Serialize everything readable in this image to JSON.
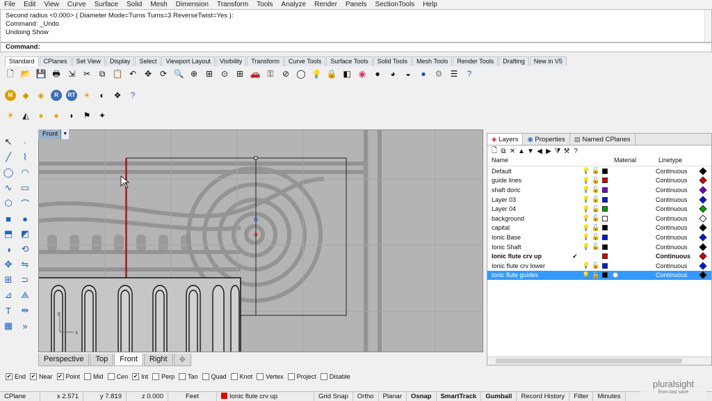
{
  "menu": [
    "File",
    "Edit",
    "View",
    "Curve",
    "Surface",
    "Solid",
    "Mesh",
    "Dimension",
    "Transform",
    "Tools",
    "Analyze",
    "Render",
    "Panels",
    "SectionTools",
    "Help"
  ],
  "history": {
    "lines": [
      "Second radius <0.000> ( Diameter  Mode=Turns  Turns=3  ReverseTwist=Yes ):",
      "Command: _Undo",
      "Undoing Show"
    ]
  },
  "command": {
    "prompt": "Command:"
  },
  "toolbar_tabs": [
    "Standard",
    "CPlanes",
    "Set View",
    "Display",
    "Select",
    "Viewport Layout",
    "Visibility",
    "Transform",
    "Curve Tools",
    "Surface Tools",
    "Solid Tools",
    "Mesh Tools",
    "Render Tools",
    "Drafting",
    "New in V5"
  ],
  "toolbar_rows": {
    "standard": [
      "new-icon",
      "open-icon",
      "save-icon",
      "print-icon",
      "import-icon",
      "cut-icon",
      "copy-icon",
      "paste-icon",
      "undo-icon",
      "pan-icon",
      "rotate-view-icon",
      "zoom-icon",
      "zoom-window-icon",
      "zoom-extents-icon",
      "zoom-selected-icon",
      "four-viewports-icon",
      "car-icon",
      "key-icon",
      "cplane-icon",
      "ellipse-icon",
      "light-icon",
      "lock-icon",
      "layer-icon",
      "color-wheel-icon",
      "sphere-icon",
      "shaded-sphere-icon",
      "render-sphere-icon",
      "blue-ball-icon",
      "gear-icon",
      "options-icon",
      "help-icon"
    ],
    "render": [
      "m-icon",
      "texture-icon",
      "label-icon",
      "r-icon",
      "rt-icon",
      "sun-icon",
      "material-icon",
      "environment-icon",
      "help-icon"
    ],
    "lights": [
      "sun-light-icon",
      "spotlight-icon",
      "point-light-icon",
      "directional-light-icon",
      "linear-light-icon",
      "flag-icon",
      "star-light-icon"
    ]
  },
  "left_tools": [
    "select-arrow-icon",
    "point-icon",
    "line-icon",
    "polyline-icon",
    "circle-icon",
    "arc-icon",
    "curve-icon",
    "rectangle-icon",
    "polygon-icon",
    "fillet-icon",
    "box-icon",
    "sphere-tool-icon",
    "extrude-icon",
    "surface-icon",
    "boolean-icon",
    "transform-icon",
    "move-icon",
    "mirror-icon",
    "array-icon",
    "join-icon",
    "analyze-icon",
    "snap-icon",
    "text-icon",
    "dim-icon",
    "group-icon",
    "more-icon"
  ],
  "viewport": {
    "title": "Front",
    "tabs": [
      "Perspective",
      "Top",
      "Front",
      "Right"
    ],
    "active_tab": "Front",
    "axis_x": "x",
    "axis_z": "z"
  },
  "panel": {
    "tabs": [
      "Layers",
      "Properties",
      "Named CPlanes"
    ],
    "headers": {
      "name": "Name",
      "material": "Material",
      "linetype": "Linetype"
    },
    "layers": [
      {
        "name": "Default",
        "color": "#000000",
        "linetype": "Continuous",
        "diamond": "#000000"
      },
      {
        "name": "guide lines",
        "color": "#d40000",
        "linetype": "Continuous",
        "diamond": "#d40000"
      },
      {
        "name": "shaft doric",
        "color": "#7a00c8",
        "linetype": "Continuous",
        "diamond": "#7a00c8"
      },
      {
        "name": "Layer 03",
        "color": "#0018e0",
        "linetype": "Continuous",
        "diamond": "#0018e0"
      },
      {
        "name": "Layer 04",
        "color": "#00a000",
        "linetype": "Continuous",
        "diamond": "#00a000"
      },
      {
        "name": "background",
        "color": "#ffffff",
        "linetype": "Continuous",
        "diamond": "#ffffff"
      },
      {
        "name": "capital",
        "color": "#000000",
        "linetype": "Continuous",
        "diamond": "#000000"
      },
      {
        "name": "Ionic Base",
        "color": "#0018e0",
        "linetype": "Continuous",
        "diamond": "#0018e0"
      },
      {
        "name": "Ionic Shaft",
        "color": "#000000",
        "linetype": "Continuous",
        "diamond": "#000000"
      },
      {
        "name": "Ionic flute crv up",
        "color": "#d40000",
        "linetype": "Continuous",
        "diamond": "#d40000",
        "current": true
      },
      {
        "name": "Ionic flute crv lower",
        "color": "#0018e0",
        "linetype": "Continuous",
        "diamond": "#0018e0"
      },
      {
        "name": "ionic flute guides",
        "color": "#000000",
        "linetype": "Continuous",
        "diamond": "#000000",
        "selected": true
      }
    ],
    "current_mark": "✔"
  },
  "osnaps": [
    {
      "label": "End",
      "checked": true
    },
    {
      "label": "Near",
      "checked": true
    },
    {
      "label": "Point",
      "checked": true
    },
    {
      "label": "Mid",
      "checked": false
    },
    {
      "label": "Cen",
      "checked": false
    },
    {
      "label": "Int",
      "checked": true
    },
    {
      "label": "Perp",
      "checked": false
    },
    {
      "label": "Tan",
      "checked": false
    },
    {
      "label": "Quad",
      "checked": false
    },
    {
      "label": "Knot",
      "checked": false
    },
    {
      "label": "Vertex",
      "checked": false
    },
    {
      "label": "Project",
      "checked": false
    },
    {
      "label": "Disable",
      "checked": false
    }
  ],
  "status": {
    "cplane": "CPlane",
    "x": "x 2.571",
    "y": "y 7.819",
    "z": "z 0.000",
    "units": "Feet",
    "layer": "Ionic flute crv up",
    "layer_color": "#e00000",
    "toggles": [
      {
        "label": "Grid Snap",
        "bold": false
      },
      {
        "label": "Ortho",
        "bold": false
      },
      {
        "label": "Planar",
        "bold": false
      },
      {
        "label": "Osnap",
        "bold": true
      },
      {
        "label": "SmartTrack",
        "bold": true
      },
      {
        "label": "Gumball",
        "bold": true
      },
      {
        "label": "Record History",
        "bold": false
      },
      {
        "label": "Filter",
        "bold": false
      }
    ],
    "minutes": "Minutes"
  },
  "watermark": {
    "brand": "pluralsight",
    "sub": "from last save"
  }
}
